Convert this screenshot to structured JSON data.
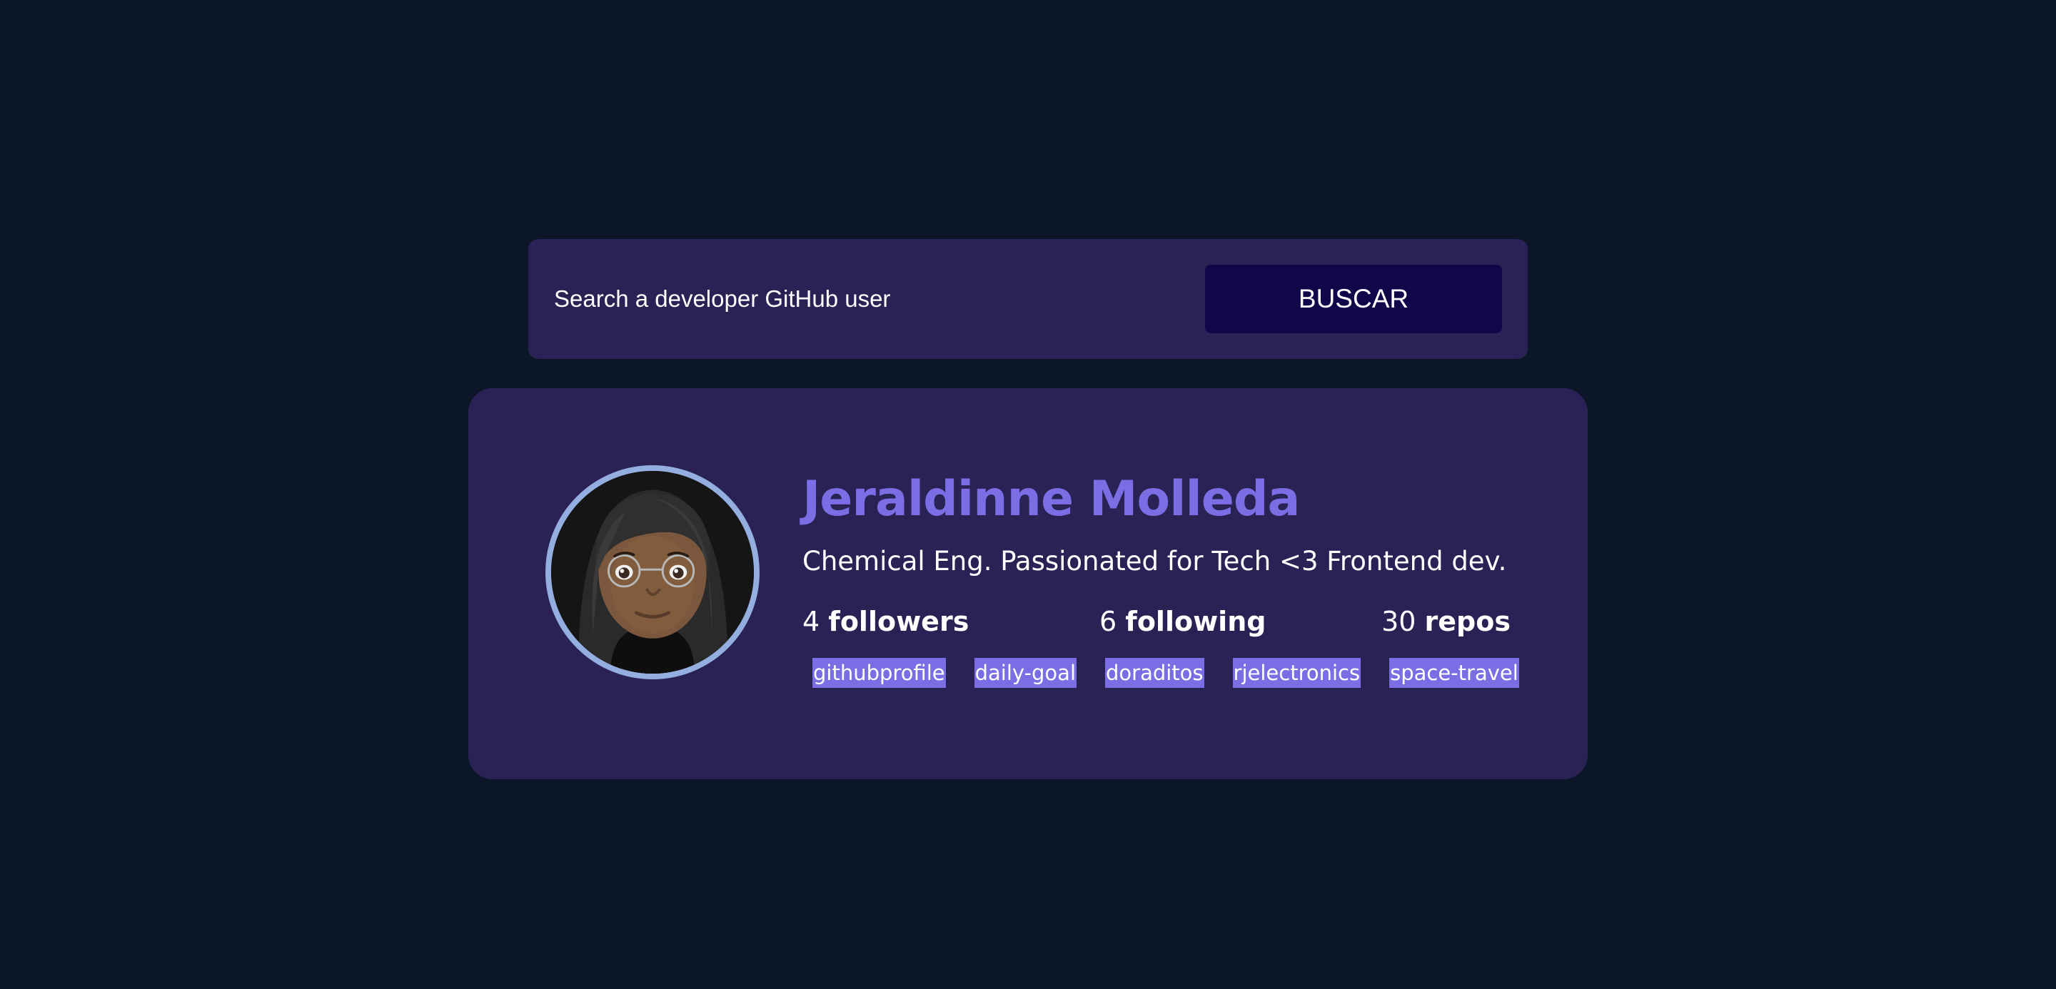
{
  "search": {
    "placeholder": "Search a developer GitHub user",
    "button_label": "BUSCAR"
  },
  "profile": {
    "name": "Jeraldinne Molleda",
    "bio": "Chemical Eng. Passionated for Tech <3 Frontend dev.",
    "avatar_icon": "memoji-avatar-icon",
    "followers_count": "4",
    "followers_label": "followers",
    "following_count": "6",
    "following_label": "following",
    "repos_count": "30",
    "repos_label": "repos",
    "repositories": [
      "githubprofile",
      "daily-goal",
      "doraditos",
      "rjelectronics",
      "space-travel"
    ]
  },
  "colors": {
    "background": "#0c1629",
    "panel": "#2a2154",
    "button": "#12064a",
    "accent": "#7b6de3",
    "avatar_ring": "#94aee0"
  }
}
